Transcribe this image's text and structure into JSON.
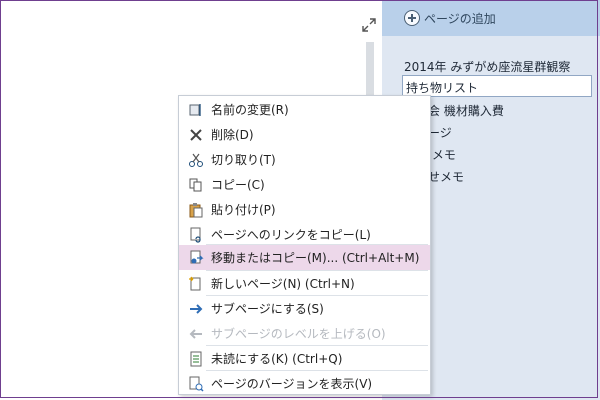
{
  "pane": {
    "add_page_label": "ページの追加",
    "pages": [
      "2014年 みずがめ座流星群観察",
      "持ち物リスト",
      "観測会 機材購入費",
      "イメージ",
      "場所 メモ",
      "合わせメモ"
    ]
  },
  "context_menu": {
    "items": [
      {
        "label": "名前の変更(R)",
        "icon": "rename-icon"
      },
      {
        "label": "削除(D)",
        "icon": "delete-icon"
      },
      {
        "label": "切り取り(T)",
        "icon": "cut-icon"
      },
      {
        "label": "コピー(C)",
        "icon": "copy-icon"
      },
      {
        "label": "貼り付け(P)",
        "icon": "paste-icon"
      },
      {
        "label": "ページへのリンクをコピー(L)",
        "icon": "link-icon"
      },
      {
        "label": "移動またはコピー(M)... (Ctrl+Alt+M)",
        "icon": "move-copy-icon"
      },
      {
        "label": "新しいページ(N) (Ctrl+N)",
        "icon": "new-page-icon"
      },
      {
        "label": "サブページにする(S)",
        "icon": "make-subpage-icon"
      },
      {
        "label": "サブページのレベルを上げる(O)",
        "icon": "promote-subpage-icon"
      },
      {
        "label": "未読にする(K) (Ctrl+Q)",
        "icon": "mark-unread-icon"
      },
      {
        "label": "ページのバージョンを表示(V)",
        "icon": "page-versions-icon"
      }
    ]
  }
}
